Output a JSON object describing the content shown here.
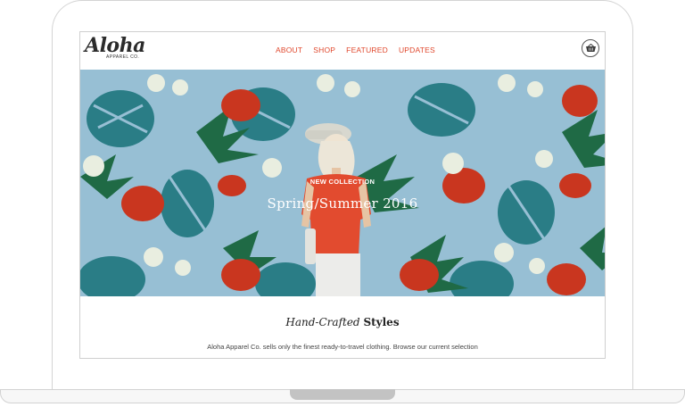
{
  "site": {
    "logo": {
      "word": "Aloha",
      "sub": "APPAREL CO."
    },
    "nav": [
      "ABOUT",
      "SHOP",
      "FEATURED",
      "UPDATES"
    ],
    "cart_icon": "basket-icon"
  },
  "hero": {
    "eyebrow": "NEW COLLECTION",
    "title": "Spring/Summer 2016",
    "background_color": "#97bfd4"
  },
  "content": {
    "heading_em": "Hand-Crafted",
    "heading_strong": "Styles",
    "body": "Aloha Apparel Co. sells only the finest ready-to-travel clothing. Browse our current selection of products or view our few updates below."
  },
  "colors": {
    "accent": "#e0482d",
    "text": "#222222"
  }
}
